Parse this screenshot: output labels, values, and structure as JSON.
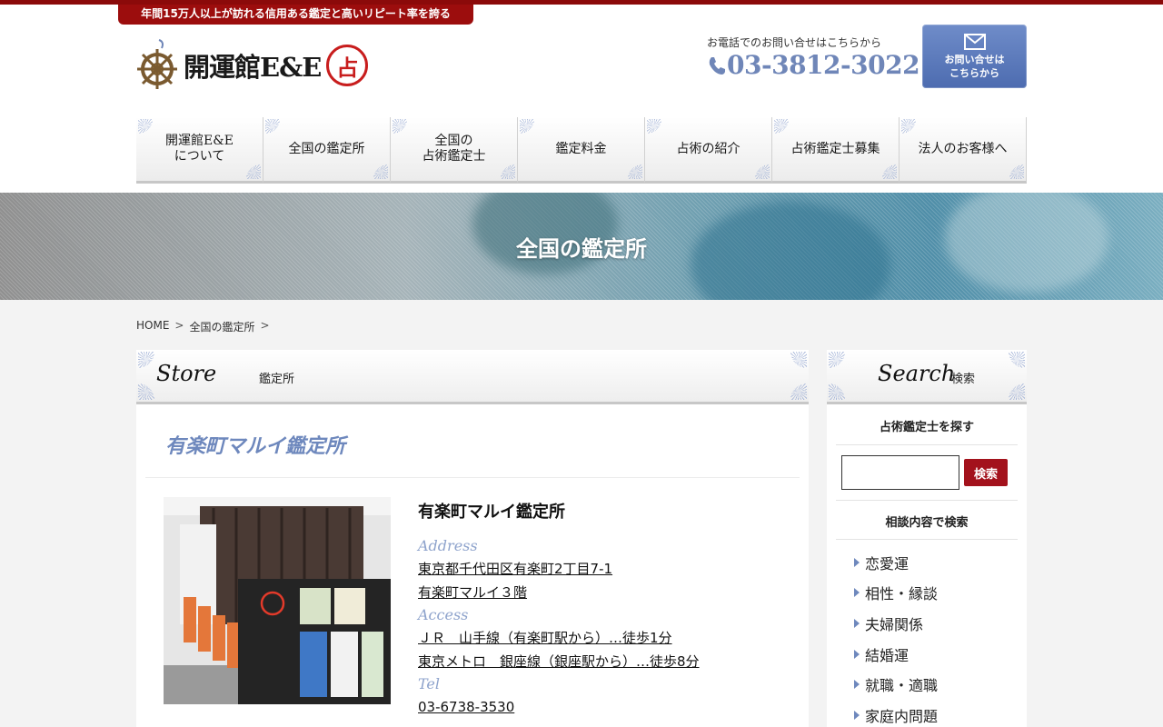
{
  "header": {
    "tagline": "年間15万人以上が訪れる信用ある鑑定と高いリピート率を誇る",
    "logo_text": "開運館E&E",
    "logo_seal": "占",
    "phone_label": "お電話でのお問い合せはこちらから",
    "phone_number": "03-3812-3022",
    "contact_line1": "お問い合せは",
    "contact_line2": "こちらから"
  },
  "nav": [
    {
      "line1": "開運館E&E",
      "line2": "について"
    },
    {
      "line1": "全国の鑑定所",
      "line2": ""
    },
    {
      "line1": "全国の",
      "line2": "占術鑑定士"
    },
    {
      "line1": "鑑定料金",
      "line2": ""
    },
    {
      "line1": "占術の紹介",
      "line2": ""
    },
    {
      "line1": "占術鑑定士募集",
      "line2": ""
    },
    {
      "line1": "法人のお客様へ",
      "line2": ""
    }
  ],
  "hero": {
    "title": "全国の鑑定所"
  },
  "breadcrumb": {
    "home": "HOME",
    "sep": ">",
    "current": "全国の鑑定所"
  },
  "main": {
    "section_en": "Store",
    "section_jp": "鑑定所",
    "store_title": "有楽町マルイ鑑定所",
    "info": {
      "name": "有楽町マルイ鑑定所",
      "address_label": "Address",
      "address_1": "東京都千代田区有楽町2丁目7-1",
      "address_2": "有楽町マルイ３階",
      "access_label": "Access",
      "access_1": "ＪＲ　山手線（有楽町駅から）…徒歩1分",
      "access_2": "東京メトロ　銀座線（銀座駅から）…徒歩8分",
      "tel_label": "Tel",
      "tel": "03-6738-3530"
    }
  },
  "sidebar": {
    "section_en": "Search",
    "section_jp": "検索",
    "find_label": "占術鑑定士を探す",
    "search_button": "検索",
    "consult_label": "相談内容で検索",
    "categories": [
      "恋愛運",
      "相性・縁談",
      "夫婦関係",
      "結婚運",
      "就職・適職",
      "家庭内問題"
    ]
  },
  "colors": {
    "brand_red": "#9c0d0d",
    "accent_blue": "#6e88bd"
  }
}
